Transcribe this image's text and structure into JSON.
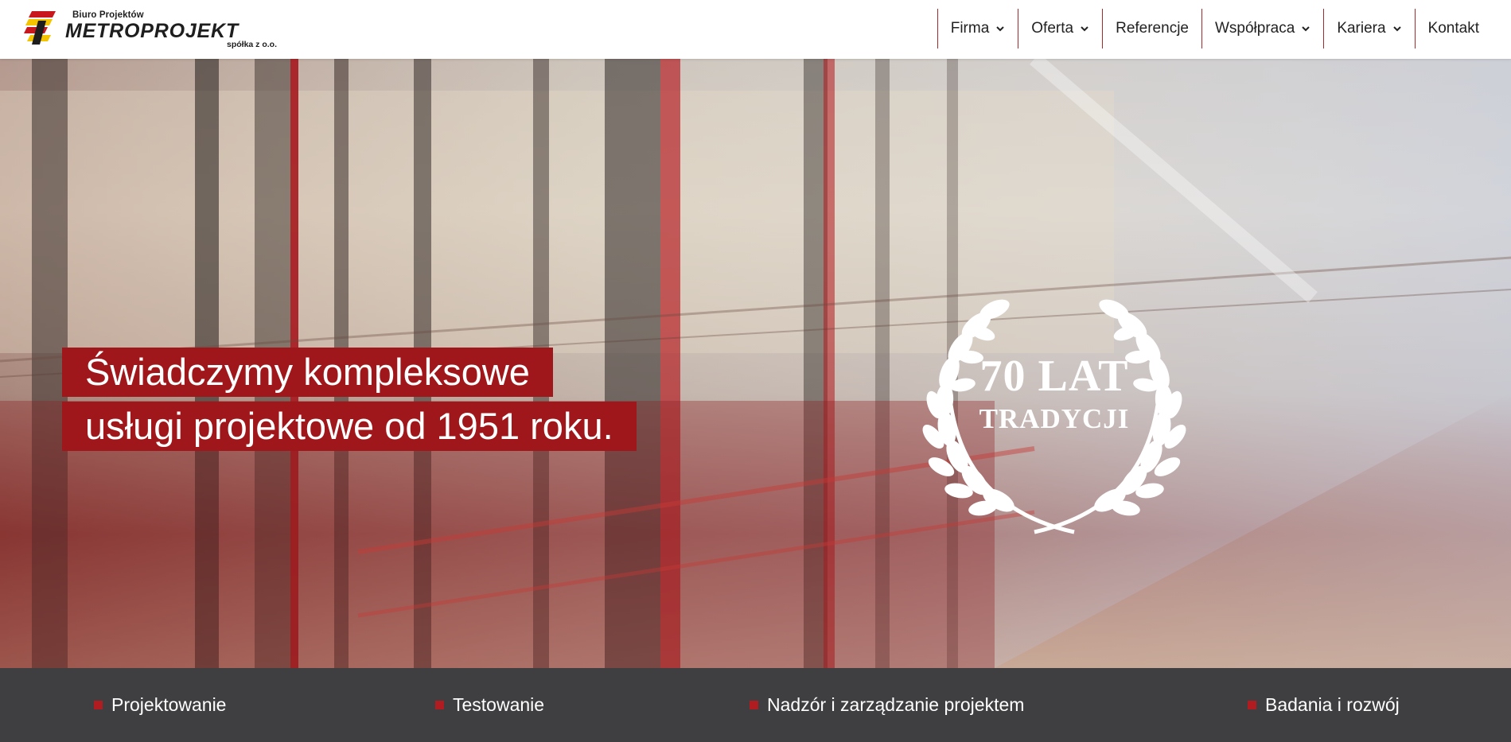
{
  "logo": {
    "top_text": "Biuro Projektów",
    "main_text": "METROPROJEKT",
    "bottom_text": "spółka z o.o.",
    "icon": "metroprojekt-logo-mark",
    "colors": {
      "red": "#c8181e",
      "yellow": "#f5c400",
      "dark": "#1e1e1e"
    }
  },
  "nav": {
    "items": [
      {
        "label": "Firma",
        "has_dropdown": true
      },
      {
        "label": "Oferta",
        "has_dropdown": true
      },
      {
        "label": "Referencje",
        "has_dropdown": false
      },
      {
        "label": "Współpraca",
        "has_dropdown": true
      },
      {
        "label": "Kariera",
        "has_dropdown": true
      },
      {
        "label": "Kontakt",
        "has_dropdown": false
      }
    ],
    "divider_color": "#a52a2a"
  },
  "hero": {
    "tagline_line1": "Świadczymy kompleksowe",
    "tagline_line2": "usługi projektowe od 1951 roku.",
    "badge_line1": "70 LAT",
    "badge_line2": "TRADYCJI",
    "badge_icon": "laurel-wreath-icon",
    "accent_color": "#a0171b"
  },
  "services": {
    "items": [
      {
        "label": "Projektowanie"
      },
      {
        "label": "Testowanie"
      },
      {
        "label": "Nadzór i zarządzanie projektem"
      },
      {
        "label": "Badania i rozwój"
      }
    ],
    "bar_color": "#3f3f42",
    "bullet_color": "#b01c1f"
  }
}
